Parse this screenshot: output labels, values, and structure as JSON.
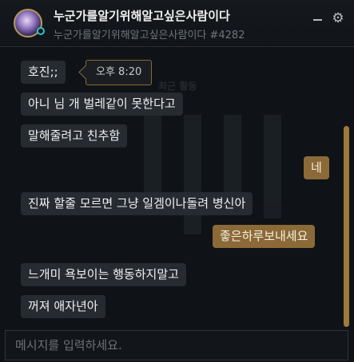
{
  "header": {
    "title": "누군가를알기위해알고싶은사람이다",
    "subtitle": "누군가를알기위해알고싶은사람이다 #4282"
  },
  "background": {
    "label": "최근 활동"
  },
  "timestamp_tooltip": "오후 8:20",
  "messages": [
    {
      "side": "received",
      "text": "호진;;"
    },
    {
      "side": "received",
      "text": "아니 님 개 벌레같이 못한다고"
    },
    {
      "side": "received",
      "text": "말해줄려고 친추함"
    },
    {
      "side": "sent",
      "text": "네"
    },
    {
      "side": "received",
      "text": "진짜 할줄 모르면 그냥 일겜이나돌려 병신아"
    },
    {
      "side": "sent",
      "text": "좋은하루보내세요"
    },
    {
      "side": "received",
      "text": "느개미 욕보이는 행동하지말고"
    },
    {
      "side": "received",
      "text": "꺼져 애자년아"
    }
  ],
  "input": {
    "placeholder": "메시지를 입력하세요."
  },
  "colors": {
    "received_bubble": "#262b31",
    "sent_bubble": "#8b6a37",
    "accent_gold": "#a07a3c",
    "status_online": "#2ec4c4"
  },
  "icons": {
    "minimize": "minimize-icon",
    "settings": "gear-icon"
  }
}
